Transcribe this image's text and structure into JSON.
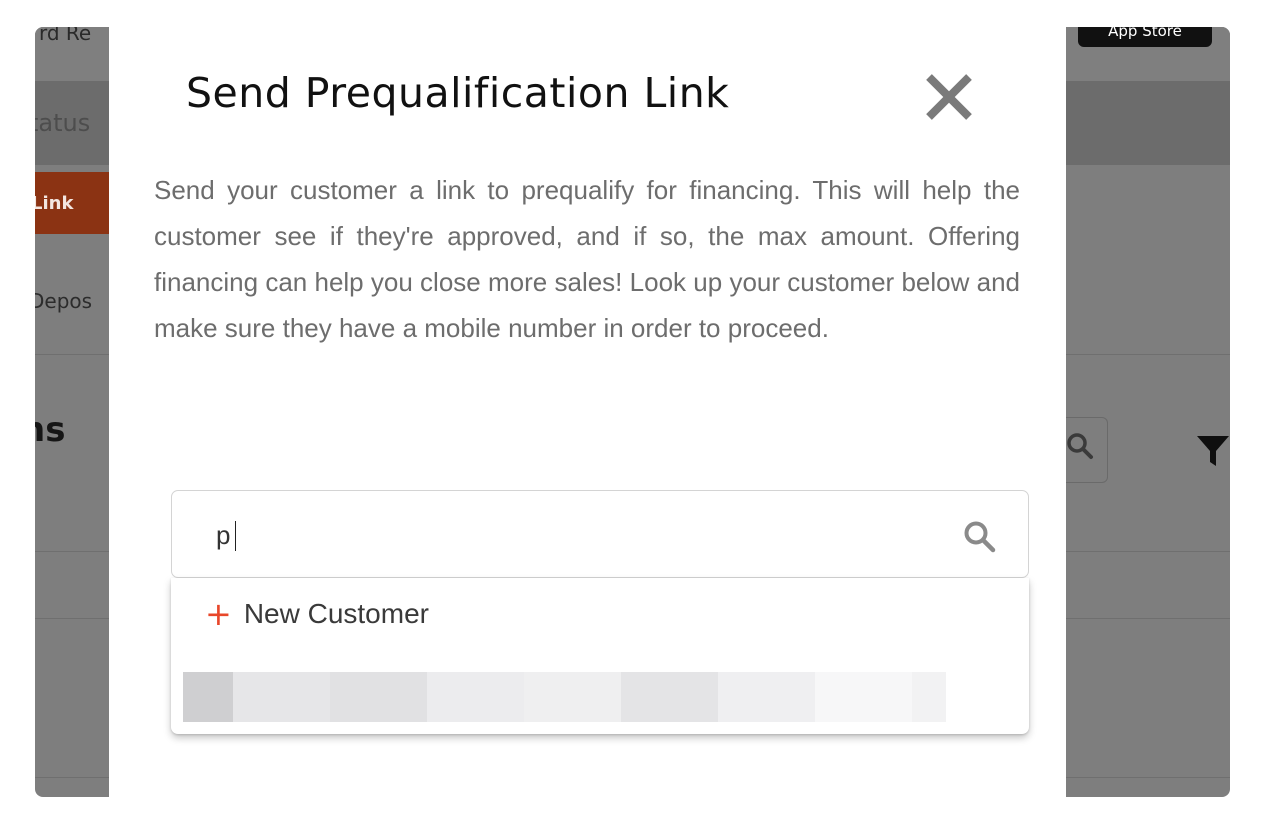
{
  "background": {
    "top_left_fragment": "rd Re",
    "app_store_label": "App Store",
    "status_fragment": "tatus",
    "link_button_fragment": "Link",
    "deposit_fragment": "Depos",
    "heading_fragment": "ns"
  },
  "modal": {
    "title": "Send Prequalification Link",
    "description": "Send your customer a link to prequalify for financing. This will help the customer see if they're approved, and if so, the max amount. Offering financing can help you close more sales! Look up your customer below and make sure they have a mobile number in order to proceed.",
    "search": {
      "value": "p",
      "placeholder": ""
    },
    "dropdown": {
      "new_customer_plus": "+",
      "new_customer_label": "New Customer"
    }
  },
  "colors": {
    "accent": "#e8472a",
    "overlay": "#7e7e7e",
    "text_muted": "#6d6d6d"
  },
  "icons": [
    "close-icon",
    "search-icon",
    "plus-icon",
    "filter-icon"
  ]
}
